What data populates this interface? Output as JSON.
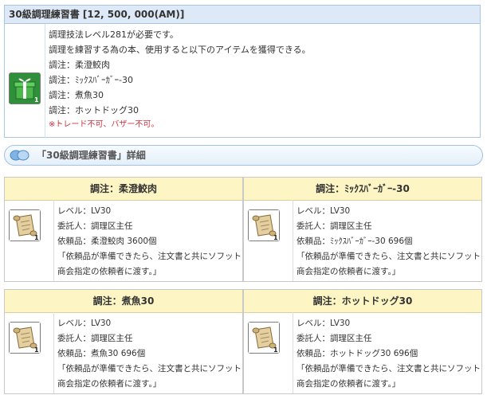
{
  "item": {
    "title": "30級調理練習書 [12, 500, 000(AM)]",
    "icon": "gift-box-icon",
    "quantity": "1",
    "lines": [
      "調理技法レベル281が必要です。",
      "調理を練習する為の本、使用すると以下のアイテムを獲得できる。",
      "調注：柔澄鮫肉",
      "調注：ﾐｯｸｽﾊﾞｰｶﾞｰ-30",
      "調注：煮魚30",
      "調注：ホットドッグ30"
    ],
    "note": "※トレード不可、バザー不可。"
  },
  "section": {
    "title": "「30級調理練習書」詳細",
    "icon": "speech-bubbles-icon"
  },
  "cards": [
    {
      "title": "調注：柔澄鮫肉",
      "icon": "scroll-icon",
      "quantity": "1",
      "level": "レベル：LV30",
      "client": "委託人：調理区主任",
      "item": "依頼品：柔澄鮫肉 3600個",
      "desc1": "「依頼品が準備できたら、注文書と共にソフット",
      "desc2": "商会指定の依頼者に渡す。」"
    },
    {
      "title": "調注：ﾐｯｸｽﾊﾞｰｶﾞｰ-30",
      "icon": "scroll-icon",
      "quantity": "1",
      "level": "レベル：LV30",
      "client": "委託人：調理区主任",
      "item": "依頼品：ﾐｯｸｽﾊﾞｰｶﾞｰ-30 696個",
      "desc1": "「依頼品が準備できたら、注文書と共にソフット",
      "desc2": "商会指定の依頼者に渡す。」"
    },
    {
      "title": "調注：煮魚30",
      "icon": "scroll-icon",
      "quantity": "1",
      "level": "レベル：LV30",
      "client": "委託人：調理区主任",
      "item": "依頼品：煮魚30 696個",
      "desc1": "「依頼品が準備できたら、注文書と共にソフット",
      "desc2": "商会指定の依頼者に渡す。」"
    },
    {
      "title": "調注：ホットドッグ30",
      "icon": "scroll-icon",
      "quantity": "1",
      "level": "レベル：LV30",
      "client": "委託人：調理区主任",
      "item": "依頼品：ホットドッグ30 696個",
      "desc1": "「依頼品が準備できたら、注文書と共にソフット",
      "desc2": "商会指定の依頼者に渡す。」"
    }
  ]
}
